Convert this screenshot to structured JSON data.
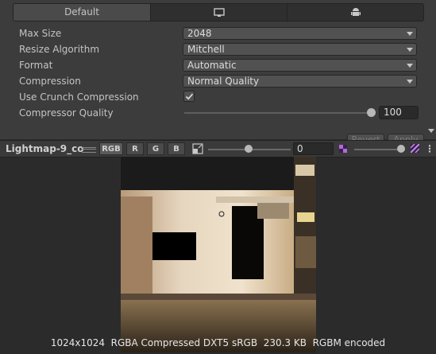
{
  "tabs": {
    "default_label": "Default",
    "standalone_icon": "monitor-icon",
    "android_icon": "android-icon"
  },
  "settings": {
    "max_size": {
      "label": "Max Size",
      "value": "2048"
    },
    "resize_algorithm": {
      "label": "Resize Algorithm",
      "value": "Mitchell"
    },
    "format": {
      "label": "Format",
      "value": "Automatic"
    },
    "compression": {
      "label": "Compression",
      "value": "Normal Quality"
    },
    "use_crunch": {
      "label": "Use Crunch Compression",
      "checked": true
    },
    "compressor_quality": {
      "label": "Compressor Quality",
      "value": "100",
      "slider_fraction": 1.0
    }
  },
  "buttons": {
    "revert": "Revert",
    "apply": "Apply"
  },
  "preview": {
    "title": "Lightmap-9_co",
    "channels": [
      "RGB",
      "R",
      "G",
      "B"
    ],
    "mip_value": "0",
    "mip_slider_fraction": 0.5,
    "exposure_slider_fraction": 0.85,
    "info": "1024x1024  RGBA Compressed DXT5 sRGB  230.3 KB  RGBM encoded"
  }
}
